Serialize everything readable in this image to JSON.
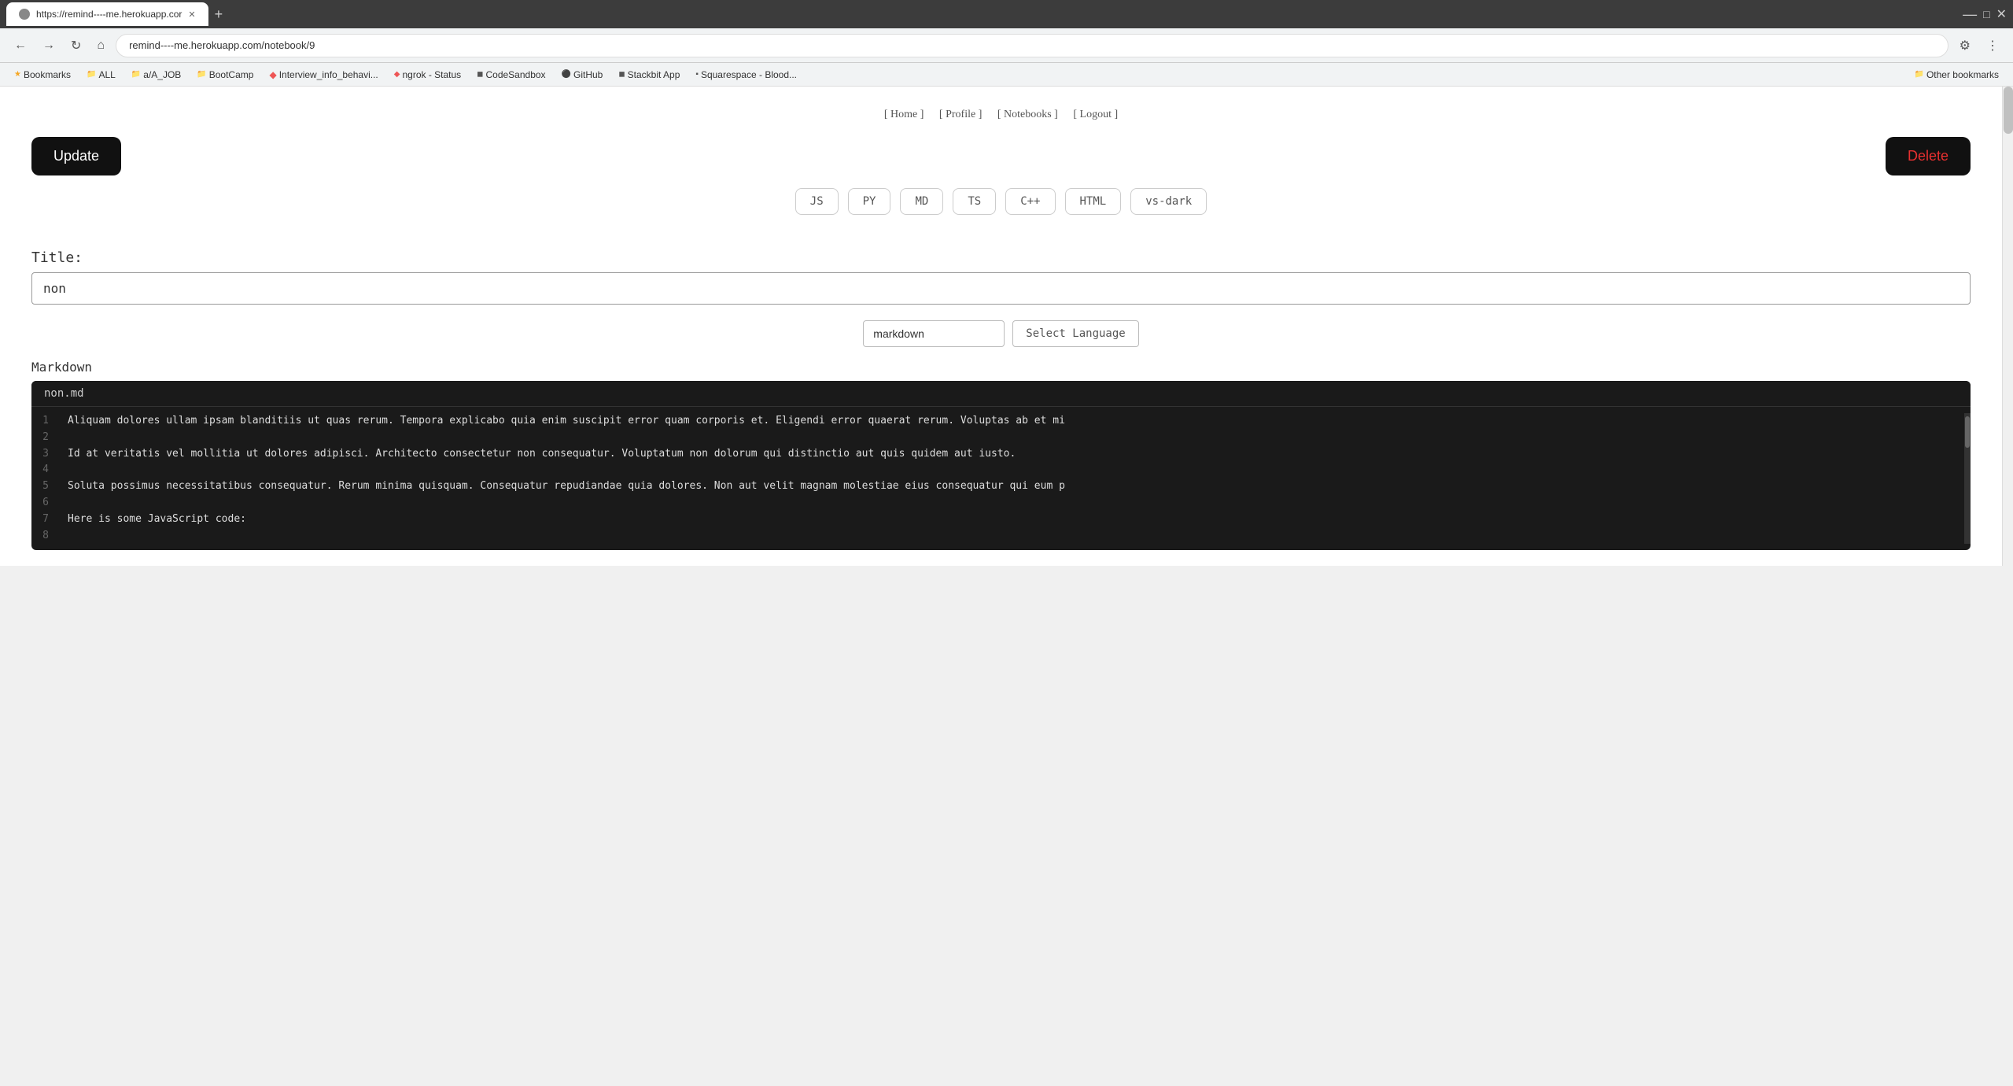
{
  "browser": {
    "tab_title": "https://remind----me.herokuapp.cor",
    "url": "remind----me.herokuapp.com/notebook/9",
    "new_tab_label": "+"
  },
  "bookmarks": [
    {
      "label": "Bookmarks",
      "icon": "★"
    },
    {
      "label": "ALL"
    },
    {
      "label": "a/A_JOB"
    },
    {
      "label": "BootCamp"
    },
    {
      "label": "Interview_info_behavi..."
    },
    {
      "label": "ngrok - Status"
    },
    {
      "label": "CodeSandbox"
    },
    {
      "label": "GitHub"
    },
    {
      "label": "Stackbit App"
    },
    {
      "label": "Squarespace - Blood..."
    },
    {
      "label": "Other bookmarks"
    }
  ],
  "nav": {
    "items": [
      {
        "label": "[ Home ]"
      },
      {
        "label": "[ Profile ]"
      },
      {
        "label": "[ Notebooks ]"
      },
      {
        "label": "[ Logout ]"
      }
    ]
  },
  "buttons": {
    "update_label": "Update",
    "delete_label": "Delete"
  },
  "lang_buttons": [
    {
      "label": "JS"
    },
    {
      "label": "PY"
    },
    {
      "label": "MD"
    },
    {
      "label": "TS"
    },
    {
      "label": "C++"
    },
    {
      "label": "HTML"
    },
    {
      "label": "vs-dark"
    }
  ],
  "title_section": {
    "label": "Title:",
    "value": "non"
  },
  "language_selector": {
    "current_value": "markdown",
    "button_label": "Select Language"
  },
  "code_section": {
    "label": "Markdown",
    "filename": "non.md",
    "lines": [
      {
        "num": "1",
        "text": "Aliquam dolores ullam ipsam blanditiis ut quas rerum. Tempora explicabo quia enim suscipit error quam corporis et. Eligendi error quaerat rerum. Voluptas ab et mi"
      },
      {
        "num": "2",
        "text": ""
      },
      {
        "num": "3",
        "text": "Id at veritatis vel mollitia ut dolores adipisci. Architecto consectetur non consequatur. Voluptatum non dolorum qui distinctio aut quis quidem aut iusto."
      },
      {
        "num": "4",
        "text": ""
      },
      {
        "num": "5",
        "text": "Soluta possimus necessitatibus consequatur. Rerum minima quisquam. Consequatur repudiandae quia dolores. Non aut velit magnam molestiae eius consequatur qui eum p"
      },
      {
        "num": "6",
        "text": ""
      },
      {
        "num": "7",
        "text": "Here is some JavaScript code:"
      },
      {
        "num": "8",
        "text": ""
      }
    ]
  }
}
